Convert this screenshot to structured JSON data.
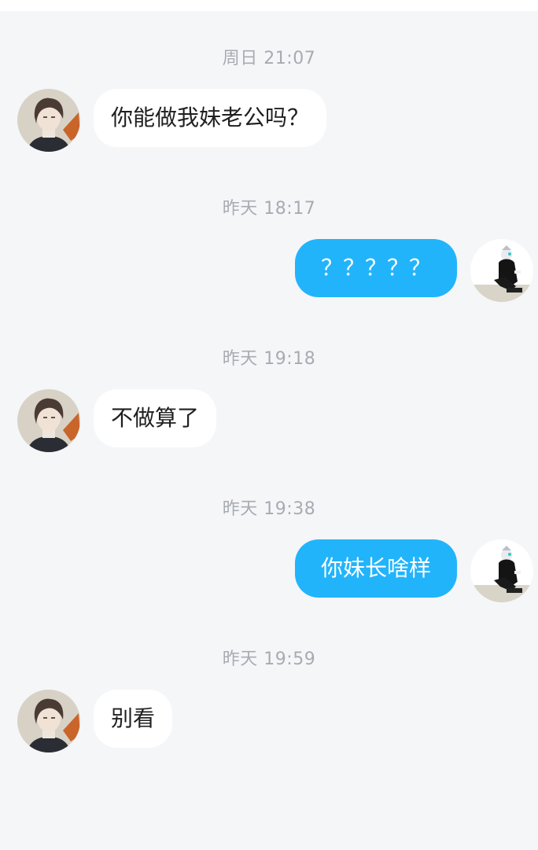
{
  "messages": [
    {
      "timestamp": "周日 21:07",
      "sender": "them",
      "text": "你能做我妹老公吗？"
    },
    {
      "timestamp": "昨天 18:17",
      "sender": "me",
      "text": "？？？？？"
    },
    {
      "timestamp": "昨天 19:18",
      "sender": "them",
      "text": "不做算了"
    },
    {
      "timestamp": "昨天 19:38",
      "sender": "me",
      "text": "你妹长啥样"
    },
    {
      "timestamp": "昨天 19:59",
      "sender": "them",
      "text": "别看"
    }
  ],
  "colors": {
    "background": "#f5f6f8",
    "incoming_bubble": "#ffffff",
    "outgoing_bubble": "#22b4fb",
    "timestamp_text": "#a7abb2"
  },
  "icons": {
    "contact_avatar": "contact-avatar-icon",
    "self_avatar": "self-avatar-icon"
  }
}
